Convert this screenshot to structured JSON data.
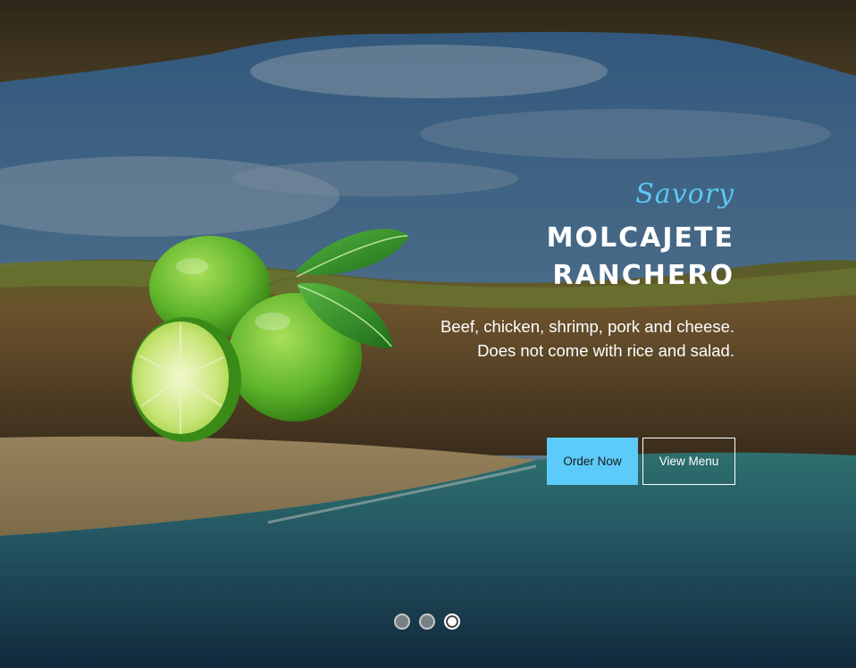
{
  "slide": {
    "eyebrow": "Savory",
    "title_line1": "MOLCAJETE",
    "title_line2": "RANCHERO",
    "description": "Beef, chicken, shrimp, pork and cheese. Does not come with rice and salad."
  },
  "buttons": {
    "order_label": "Order Now",
    "menu_label": "View Menu"
  },
  "pagination": {
    "total": 3,
    "active_index": 3
  },
  "colors": {
    "accent": "#5ccbfa",
    "text": "#ffffff"
  },
  "images": {
    "background": "sea-cave-beach-photo",
    "foreground": "limes-photo"
  }
}
